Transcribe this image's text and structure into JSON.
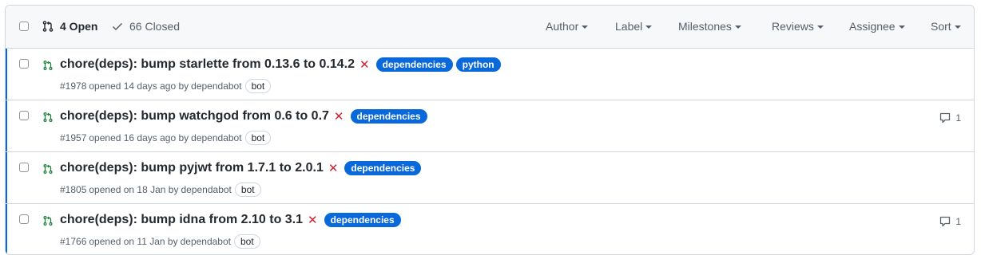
{
  "header": {
    "open_label": "4 Open",
    "closed_label": "66 Closed",
    "filters": {
      "author": "Author",
      "label": "Label",
      "milestones": "Milestones",
      "reviews": "Reviews",
      "assignee": "Assignee",
      "sort": "Sort"
    }
  },
  "pulls": [
    {
      "title": "chore(deps): bump starlette from 0.13.6 to 0.14.2",
      "labels": [
        "dependencies",
        "python"
      ],
      "number": "#1978",
      "opened": "opened 14 days ago by",
      "author": "dependabot",
      "author_badge": "bot",
      "comments": ""
    },
    {
      "title": "chore(deps): bump watchgod from 0.6 to 0.7",
      "labels": [
        "dependencies"
      ],
      "number": "#1957",
      "opened": "opened 16 days ago by",
      "author": "dependabot",
      "author_badge": "bot",
      "comments": "1"
    },
    {
      "title": "chore(deps): bump pyjwt from 1.7.1 to 2.0.1",
      "labels": [
        "dependencies"
      ],
      "number": "#1805",
      "opened": "opened on 18 Jan by",
      "author": "dependabot",
      "author_badge": "bot",
      "comments": ""
    },
    {
      "title": "chore(deps): bump idna from 2.10 to 3.1",
      "labels": [
        "dependencies"
      ],
      "number": "#1766",
      "opened": "opened on 11 Jan by",
      "author": "dependabot",
      "author_badge": "bot",
      "comments": "1"
    }
  ],
  "colors": {
    "label_bg": "#0969da",
    "pr_open": "#1a7f37",
    "status_fail": "#cf222e",
    "accent": "#0969da"
  },
  "icons": {
    "open": "git-pull-request-icon",
    "closed": "check-icon",
    "status": "x-icon",
    "comment": "comment-icon"
  }
}
